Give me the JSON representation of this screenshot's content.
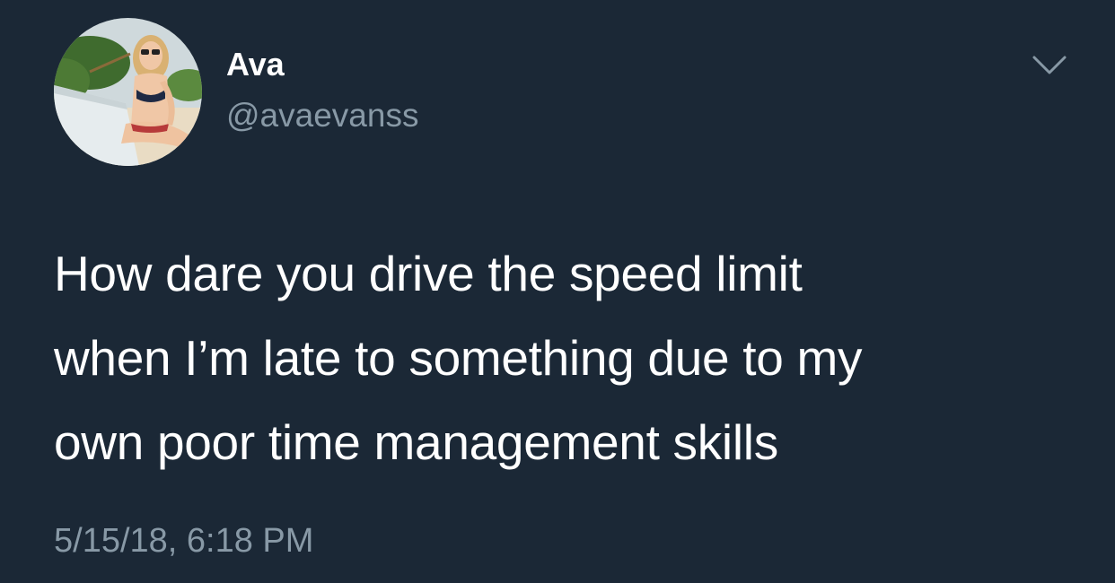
{
  "tweet": {
    "author": {
      "display_name": "Ava",
      "handle": "@avaevanss"
    },
    "text": "How dare you drive the speed limit\nwhen I’m late to something due to my\nown poor time management skills",
    "timestamp": "5/15/18, 6:18 PM",
    "menu_icon": "chevron-down-icon"
  },
  "colors": {
    "background": "#1b2836",
    "primary_text": "#ffffff",
    "secondary_text": "#8899a6"
  }
}
